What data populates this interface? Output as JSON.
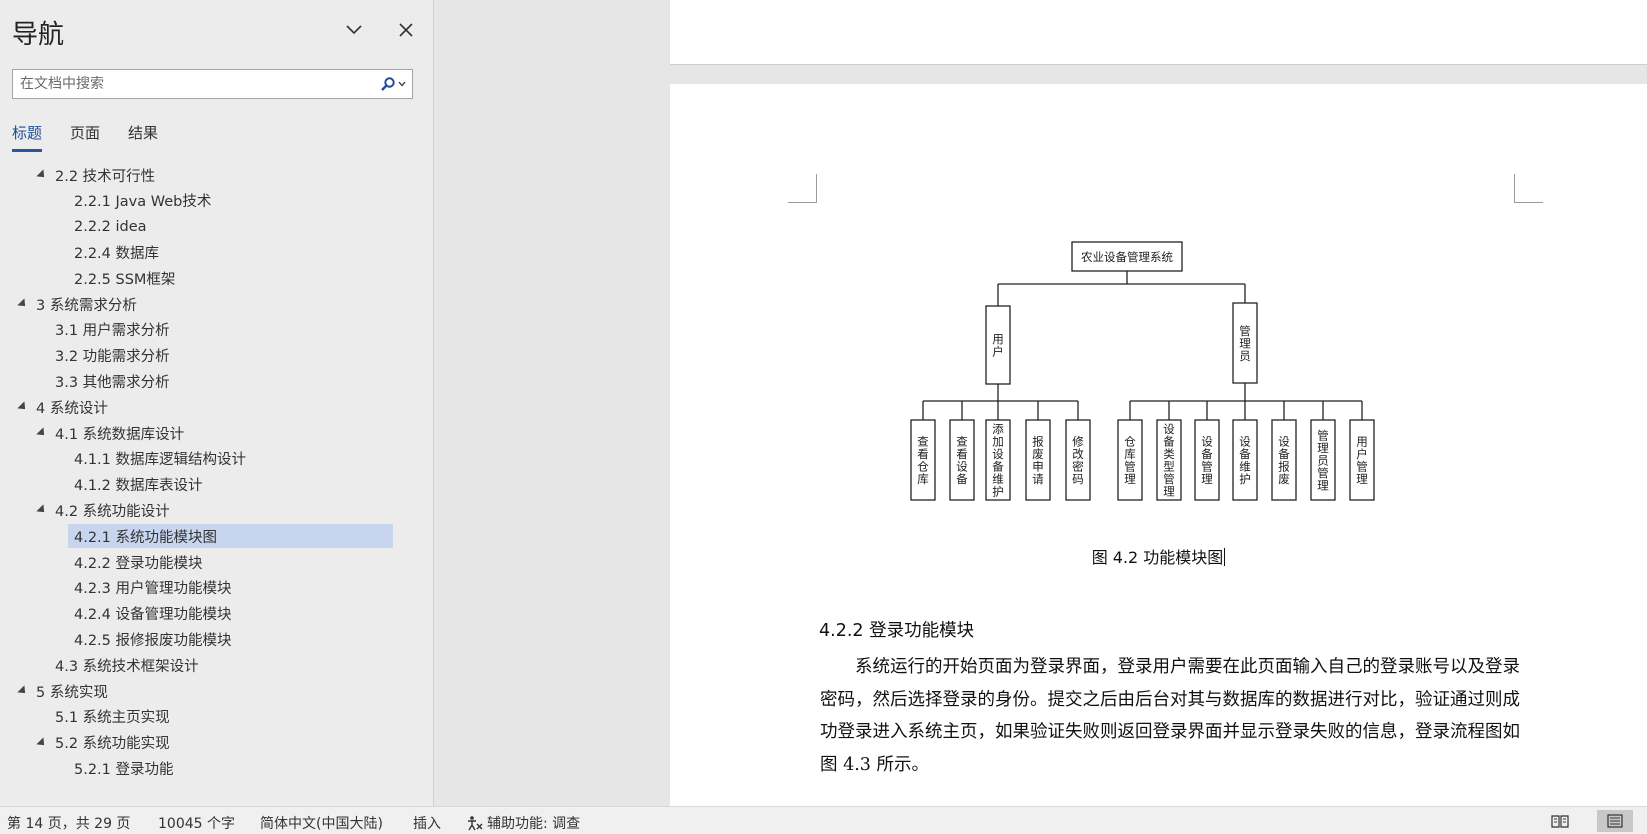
{
  "nav": {
    "title": "导航",
    "search_placeholder": "在文档中搜索",
    "tabs": [
      {
        "label": "标题",
        "active": true
      },
      {
        "label": "页面",
        "active": false
      },
      {
        "label": "结果",
        "active": false
      }
    ],
    "headings": [
      {
        "text": "2.2 技术可行性",
        "level": 2,
        "expanded": true
      },
      {
        "text": "2.2.1 Java Web技术",
        "level": 3
      },
      {
        "text": "2.2.2 idea",
        "level": 3
      },
      {
        "text": "2.2.4 数据库",
        "level": 3
      },
      {
        "text": "2.2.5 SSM框架",
        "level": 3
      },
      {
        "text": "3 系统需求分析",
        "level": 1,
        "expanded": true
      },
      {
        "text": "3.1 用户需求分析",
        "level": 2
      },
      {
        "text": "3.2 功能需求分析",
        "level": 2
      },
      {
        "text": "3.3 其他需求分析",
        "level": 2
      },
      {
        "text": "4 系统设计",
        "level": 1,
        "expanded": true
      },
      {
        "text": "4.1 系统数据库设计",
        "level": 2,
        "expanded": true
      },
      {
        "text": "4.1.1 数据库逻辑结构设计",
        "level": 3
      },
      {
        "text": "4.1.2 数据库表设计",
        "level": 3
      },
      {
        "text": "4.2 系统功能设计",
        "level": 2,
        "expanded": true
      },
      {
        "text": "4.2.1 系统功能模块图",
        "level": 3,
        "selected": true
      },
      {
        "text": "4.2.2 登录功能模块",
        "level": 3
      },
      {
        "text": "4.2.3 用户管理功能模块",
        "level": 3
      },
      {
        "text": "4.2.4 设备管理功能模块",
        "level": 3
      },
      {
        "text": "4.2.5 报修报废功能模块",
        "level": 3
      },
      {
        "text": "4.3 系统技术框架设计",
        "level": 2
      },
      {
        "text": "5 系统实现",
        "level": 1,
        "expanded": true
      },
      {
        "text": "5.1 系统主页实现",
        "level": 2
      },
      {
        "text": "5.2 系统功能实现",
        "level": 2,
        "expanded": true
      },
      {
        "text": "5.2.1 登录功能",
        "level": 3
      }
    ]
  },
  "diagram": {
    "root": "农业设备管理系统",
    "branches": [
      {
        "label": "用户",
        "children": [
          "查看仓库",
          "查看设备",
          "添加设备维护",
          "报废申请",
          "修改密码"
        ]
      },
      {
        "label": "管理员",
        "children": [
          "仓库管理",
          "设备类型管理",
          "设备管理",
          "设备维护",
          "设备报废",
          "管理员管理",
          "用户管理"
        ]
      }
    ]
  },
  "document": {
    "caption": "图 4.2  功能模块图",
    "section_title": "4.2.2  登录功能模块",
    "paragraph": "系统运行的开始页面为登录界面，登录用户需要在此页面输入自己的登录账号以及登录密码，然后选择登录的身份。提交之后由后台对其与数据库的数据进行对比，验证通过则成功登录进入系统主页，如果验证失败则返回登录界面并显示登录失败的信息，登录流程图如图 4.3 所示。"
  },
  "status": {
    "page": "第 14 页，共 29 页",
    "words": "10045 个字",
    "language": "简体中文(中国大陆)",
    "mode": "插入",
    "accessibility": "辅助功能: 调查"
  }
}
